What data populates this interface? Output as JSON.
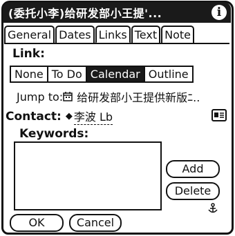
{
  "window": {
    "title": "(委托小李)给研发部小王提'...",
    "info_icon": "info-icon"
  },
  "tabs": [
    {
      "label": "General",
      "active": false
    },
    {
      "label": "Dates",
      "active": false
    },
    {
      "label": "Links",
      "active": true
    },
    {
      "label": "Text",
      "active": false
    },
    {
      "label": "Note",
      "active": false
    }
  ],
  "link": {
    "label": "Link:",
    "options": [
      {
        "label": "None",
        "selected": false
      },
      {
        "label": "To Do",
        "selected": false
      },
      {
        "label": "Calendar",
        "selected": true
      },
      {
        "label": "Outline",
        "selected": false
      }
    ],
    "jump_to_label": "Jump to:",
    "jump_to_icon": "calendar-link-icon",
    "jump_to_text": "给研发部小王提供新版ﾆ.."
  },
  "contact": {
    "label": "Contact:",
    "marker": "◆",
    "name": "李波 Lb",
    "card_icon": "address-card-icon"
  },
  "keywords": {
    "label": "Keywords:",
    "value": ""
  },
  "buttons": {
    "add": "Add",
    "delete": "Delete",
    "ok": "OK",
    "cancel": "Cancel"
  },
  "status_icon": "anchor-icon",
  "colors": {
    "title_bg": "#1a1a1a",
    "selected_bg": "#1a1a1a",
    "foreground": "#111111",
    "background": "#ffffff"
  }
}
